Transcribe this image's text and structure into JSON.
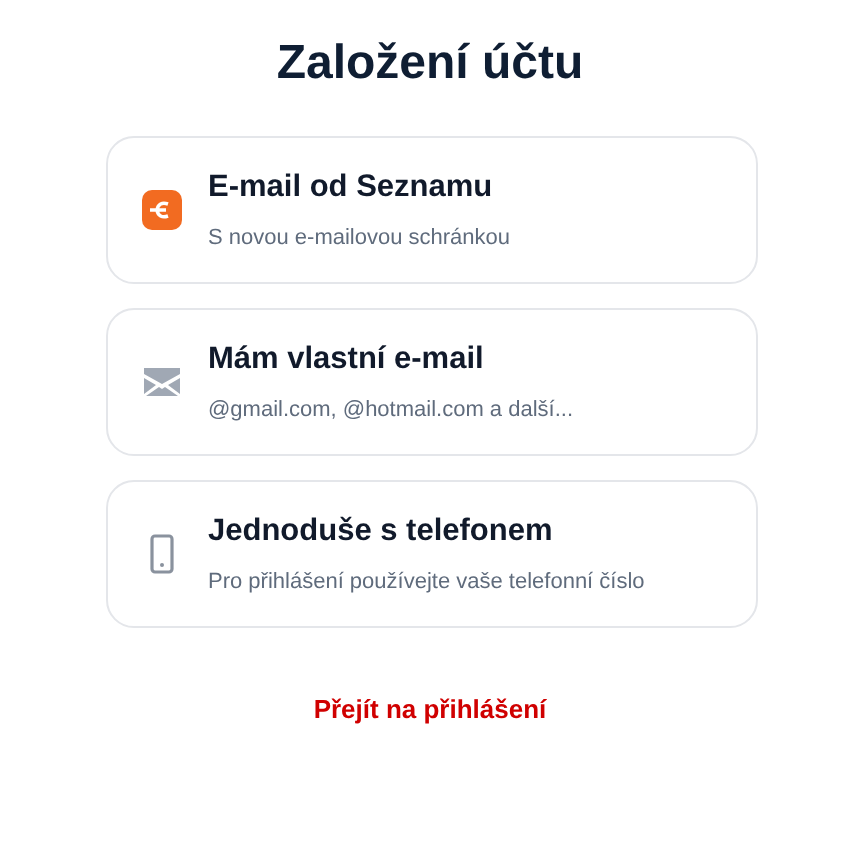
{
  "title": "Založení účtu",
  "options": [
    {
      "kind": "seznam",
      "title": "E-mail od Seznamu",
      "subtitle": "S novou e-mailovou schránkou"
    },
    {
      "kind": "mail",
      "title": "Mám vlastní e-mail",
      "subtitle": "@gmail.com, @hotmail.com a další..."
    },
    {
      "kind": "phone",
      "title": "Jednoduše s telefonem",
      "subtitle": "Pro přihlášení používejte vaše telefonní číslo"
    }
  ],
  "login_link": "Přejít na přihlášení"
}
